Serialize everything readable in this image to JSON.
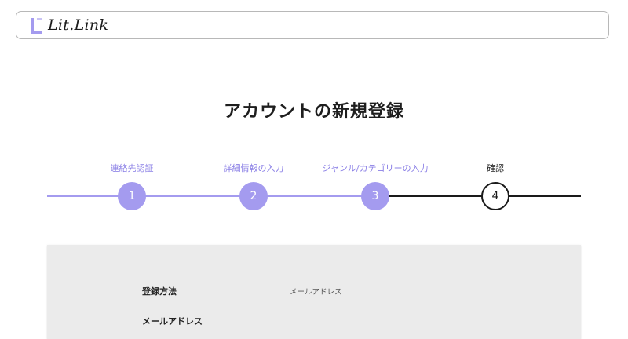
{
  "header": {
    "logo_text": "Lit.Link",
    "accent": "#a49bef"
  },
  "page": {
    "title": "アカウントの新規登録"
  },
  "stepper": {
    "colors": {
      "done": "#a49bef",
      "pending_line": "#1a1a1a"
    },
    "steps": [
      {
        "label": "連絡先認証",
        "number": "1",
        "state": "done"
      },
      {
        "label": "詳細情報の入力",
        "number": "2",
        "state": "done"
      },
      {
        "label": "ジャンル/カテゴリーの入力",
        "number": "3",
        "state": "done"
      },
      {
        "label": "確認",
        "number": "4",
        "state": "current"
      }
    ]
  },
  "confirm": {
    "rows": [
      {
        "label": "登録方法",
        "value": "メールアドレス"
      },
      {
        "label": "メールアドレス",
        "value": ""
      }
    ]
  }
}
